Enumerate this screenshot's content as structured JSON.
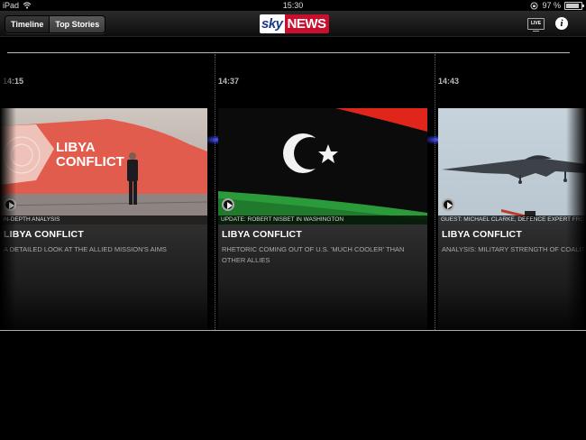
{
  "statusbar": {
    "device": "iPad",
    "time": "15:30",
    "battery": "97 %",
    "battery_level": 0.97
  },
  "navbar": {
    "tabs": [
      {
        "label": "Timeline",
        "active": false
      },
      {
        "label": "Top Stories",
        "active": true
      }
    ],
    "logo_sky": "sky",
    "logo_news": "NEWS",
    "live_label": "LIVE",
    "info_label": "i"
  },
  "stories": [
    {
      "time": "14:15",
      "caption": "In-depth analysis",
      "headline": "LIBYA CONFLICT",
      "summary": "A detailed look at the allied mission's aims",
      "thumb_text": "LIBYA CONFLICT"
    },
    {
      "time": "14:37",
      "caption": "Update: Robert Nisbet in Washington",
      "headline": "LIBYA CONFLICT",
      "summary": "Rhetoric coming out of U.S. 'much cooler' than other allies"
    },
    {
      "time": "14:43",
      "caption": "Guest: Michael Clarke, Defence Expert from",
      "headline": "LIBYA CONFLICT",
      "summary": "Analysis: Military strength of coalition"
    }
  ],
  "colors": {
    "sky_blue": "#1a3b8c",
    "news_red": "#c8102e",
    "libya_flag_red": "#e0251b",
    "libya_flag_green": "#2a9a3a",
    "glow_blue": "#4f5bff"
  }
}
